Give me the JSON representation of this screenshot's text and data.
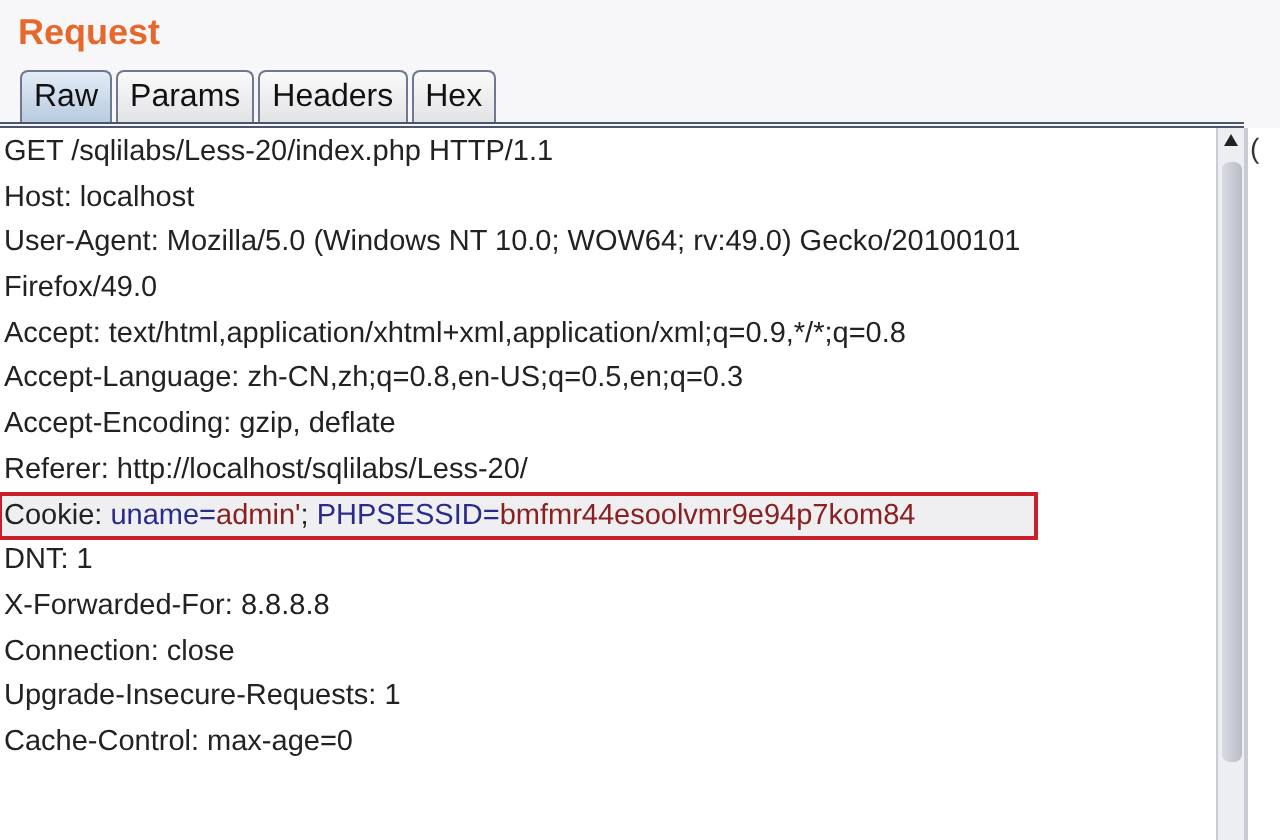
{
  "title": "Request",
  "tabs": [
    {
      "label": "Raw",
      "selected": true
    },
    {
      "label": "Params",
      "selected": false
    },
    {
      "label": "Headers",
      "selected": false
    },
    {
      "label": "Hex",
      "selected": false
    }
  ],
  "lines": [
    {
      "highlighted": false,
      "annotated": false,
      "segments": [
        {
          "kind": "plain",
          "text": "GET /sqlilabs/Less-20/index.php HTTP/1.1"
        }
      ]
    },
    {
      "highlighted": false,
      "annotated": false,
      "segments": [
        {
          "kind": "plain",
          "text": "Host: localhost"
        }
      ]
    },
    {
      "highlighted": false,
      "annotated": false,
      "segments": [
        {
          "kind": "plain",
          "text": "User-Agent: Mozilla/5.0 (Windows NT 10.0; WOW64; rv:49.0) Gecko/20100101"
        }
      ]
    },
    {
      "highlighted": false,
      "annotated": false,
      "segments": [
        {
          "kind": "plain",
          "text": "Firefox/49.0"
        }
      ]
    },
    {
      "highlighted": false,
      "annotated": false,
      "segments": [
        {
          "kind": "plain",
          "text": "Accept: text/html,application/xhtml+xml,application/xml;q=0.9,*/*;q=0.8"
        }
      ]
    },
    {
      "highlighted": false,
      "annotated": false,
      "segments": [
        {
          "kind": "plain",
          "text": "Accept-Language: zh-CN,zh;q=0.8,en-US;q=0.5,en;q=0.3"
        }
      ]
    },
    {
      "highlighted": false,
      "annotated": false,
      "segments": [
        {
          "kind": "plain",
          "text": "Accept-Encoding: gzip, deflate"
        }
      ]
    },
    {
      "highlighted": false,
      "annotated": false,
      "segments": [
        {
          "kind": "plain",
          "text": "Referer: http://localhost/sqlilabs/Less-20/"
        }
      ]
    },
    {
      "highlighted": true,
      "annotated": true,
      "segments": [
        {
          "kind": "plain",
          "text": "Cookie: "
        },
        {
          "kind": "param_name",
          "text": "uname="
        },
        {
          "kind": "param_value",
          "text": "admin'"
        },
        {
          "kind": "plain",
          "text": "; "
        },
        {
          "kind": "param_name",
          "text": "PHPSESSID="
        },
        {
          "kind": "param_value",
          "text": "bmfmr44esoolvmr9e94p7kom84"
        }
      ]
    },
    {
      "highlighted": false,
      "annotated": false,
      "segments": [
        {
          "kind": "plain",
          "text": "DNT: 1"
        }
      ]
    },
    {
      "highlighted": false,
      "annotated": false,
      "segments": [
        {
          "kind": "plain",
          "text": "X-Forwarded-For: 8.8.8.8"
        }
      ]
    },
    {
      "highlighted": false,
      "annotated": false,
      "segments": [
        {
          "kind": "plain",
          "text": "Connection: close"
        }
      ]
    },
    {
      "highlighted": false,
      "annotated": false,
      "segments": [
        {
          "kind": "plain",
          "text": "Upgrade-Insecure-Requests: 1"
        }
      ]
    },
    {
      "highlighted": false,
      "annotated": false,
      "segments": [
        {
          "kind": "plain",
          "text": "Cache-Control: max-age=0"
        }
      ]
    }
  ],
  "side_panel": {
    "text": "("
  }
}
